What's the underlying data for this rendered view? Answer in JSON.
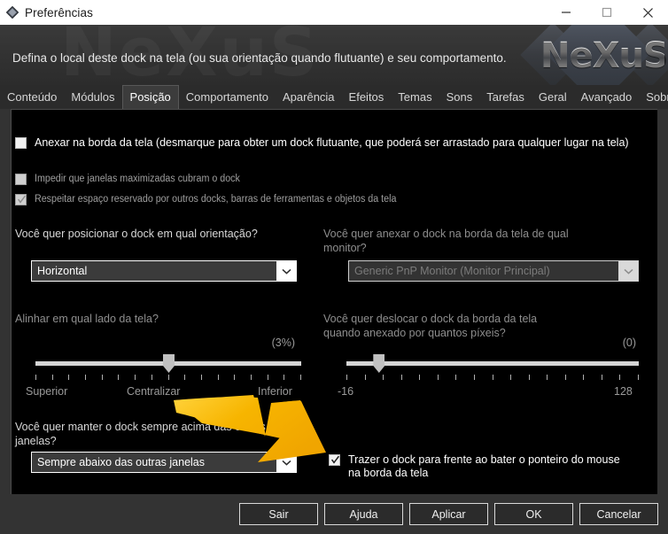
{
  "window": {
    "title": "Preferências",
    "icon": "diamond-icon",
    "minimize_label": "–",
    "maximize_label": "□",
    "close_label": "✕"
  },
  "header": {
    "description": "Defina o local deste dock na tela (ou sua orientação quando flutuante) e seu comportamento.",
    "watermark": "NeXuS",
    "logo_text": "NeXuS"
  },
  "tabs": {
    "active": "Posição",
    "items": [
      {
        "label": "Conteúdo"
      },
      {
        "label": "Módulos"
      },
      {
        "label": "Posição"
      },
      {
        "label": "Comportamento"
      },
      {
        "label": "Aparência"
      },
      {
        "label": "Efeitos"
      },
      {
        "label": "Temas"
      },
      {
        "label": "Sons"
      },
      {
        "label": "Tarefas"
      },
      {
        "label": "Geral"
      },
      {
        "label": "Avançado"
      },
      {
        "label": "Sobre"
      }
    ]
  },
  "main": {
    "checkboxes": [
      {
        "label": "Anexar na borda da tela (desmarque para obter um dock flutuante, que poderá ser arrastado para qualquer lugar na tela)",
        "checked": false,
        "enabled": true
      },
      {
        "label": "Impedir que janelas maximizadas cubram o dock",
        "checked": false,
        "enabled": false
      },
      {
        "label": "Respeitar espaço reservado por outros docks, barras de ferramentas e objetos da tela",
        "checked": true,
        "enabled": false
      }
    ],
    "orientation": {
      "question": "Você quer posicionar o dock em qual orientação?",
      "value": "Horizontal",
      "enabled": true
    },
    "monitor": {
      "question_line1": "Você quer anexar o dock na borda da tela de qual",
      "question_line2": "monitor?",
      "value": "Generic PnP Monitor (Monitor Principal)",
      "enabled": false
    },
    "align_slider": {
      "question": "Alinhar em qual lado da tela?",
      "value_display": "(3%)",
      "value": 3,
      "min": 0,
      "max": 100,
      "left_label": "Superior",
      "center_label": "Centralizar",
      "right_label": "Inferior",
      "tick_count": 17,
      "thumb_percent": 50
    },
    "offset_slider": {
      "question_line1": "Você quer deslocar o dock da borda da tela",
      "question_line2": "quando anexado por quantos píxeis?",
      "value_display": "(0)",
      "value": 0,
      "min": -16,
      "max": 128,
      "left_label": "-16",
      "right_label": "128",
      "tick_count": 17,
      "thumb_percent": 11
    },
    "zorder": {
      "question_line1": "Você quer manter o dock sempre acima das outras",
      "question_line2": "janelas?",
      "value": "Sempre abaixo das outras janelas",
      "enabled": true
    },
    "front_on_hover": {
      "label_line1": "Trazer o dock para frente ao bater o ponteiro do mouse",
      "label_line2": "na borda da tela",
      "checked": true,
      "enabled": true
    }
  },
  "annotation": {
    "arrow_color": "#F5A800",
    "arrow_name": "highlight-arrow"
  },
  "footer": {
    "buttons": [
      {
        "label": "Sair"
      },
      {
        "label": "Ajuda"
      },
      {
        "label": "Aplicar"
      },
      {
        "label": "OK"
      },
      {
        "label": "Cancelar"
      }
    ]
  }
}
